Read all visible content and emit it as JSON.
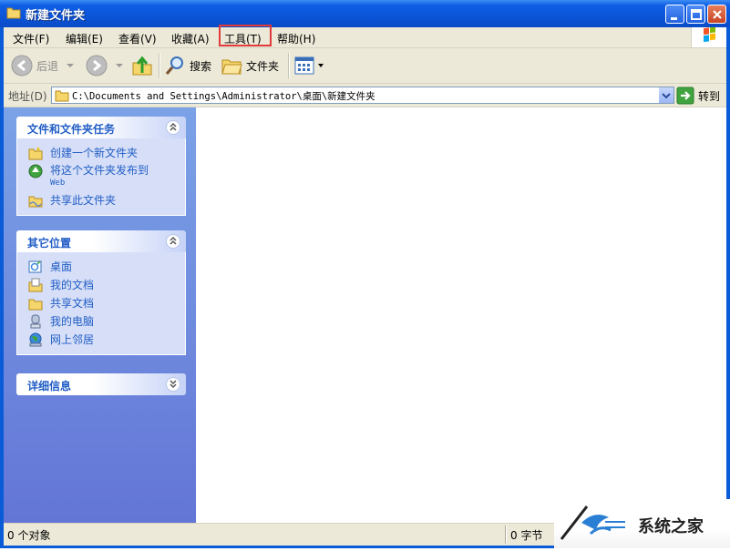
{
  "window": {
    "title": "新建文件夹"
  },
  "menu": [
    {
      "label": "文件(F)"
    },
    {
      "label": "编辑(E)"
    },
    {
      "label": "查看(V)"
    },
    {
      "label": "收藏(A)"
    },
    {
      "label": "工具(T)"
    },
    {
      "label": "帮助(H)"
    }
  ],
  "toolbar": {
    "back": "后退",
    "search": "搜索",
    "folders": "文件夹"
  },
  "address": {
    "label": "地址(D)",
    "path": "C:\\Documents and Settings\\Administrator\\桌面\\新建文件夹",
    "go": "转到"
  },
  "tasks": {
    "title": "文件和文件夹任务",
    "items": [
      {
        "label": "创建一个新文件夹",
        "icon": "new-folder-icon"
      },
      {
        "label": "将这个文件夹发布到",
        "sub": "Web",
        "icon": "publish-web-icon"
      },
      {
        "label": "共享此文件夹",
        "icon": "share-folder-icon"
      }
    ]
  },
  "places": {
    "title": "其它位置",
    "items": [
      {
        "label": "桌面",
        "icon": "desktop-icon"
      },
      {
        "label": "我的文档",
        "icon": "my-documents-icon"
      },
      {
        "label": "共享文档",
        "icon": "shared-documents-icon"
      },
      {
        "label": "我的电脑",
        "icon": "my-computer-icon"
      },
      {
        "label": "网上邻居",
        "icon": "network-places-icon"
      }
    ]
  },
  "details": {
    "title": "详细信息"
  },
  "status": {
    "objects": "0 个对象",
    "size": "0 字节"
  },
  "watermark": {
    "text": "系统之家"
  },
  "colors": {
    "title_bar": "#0A52D4",
    "highlight": "#E03A3A",
    "panel_link": "#215DC6"
  }
}
